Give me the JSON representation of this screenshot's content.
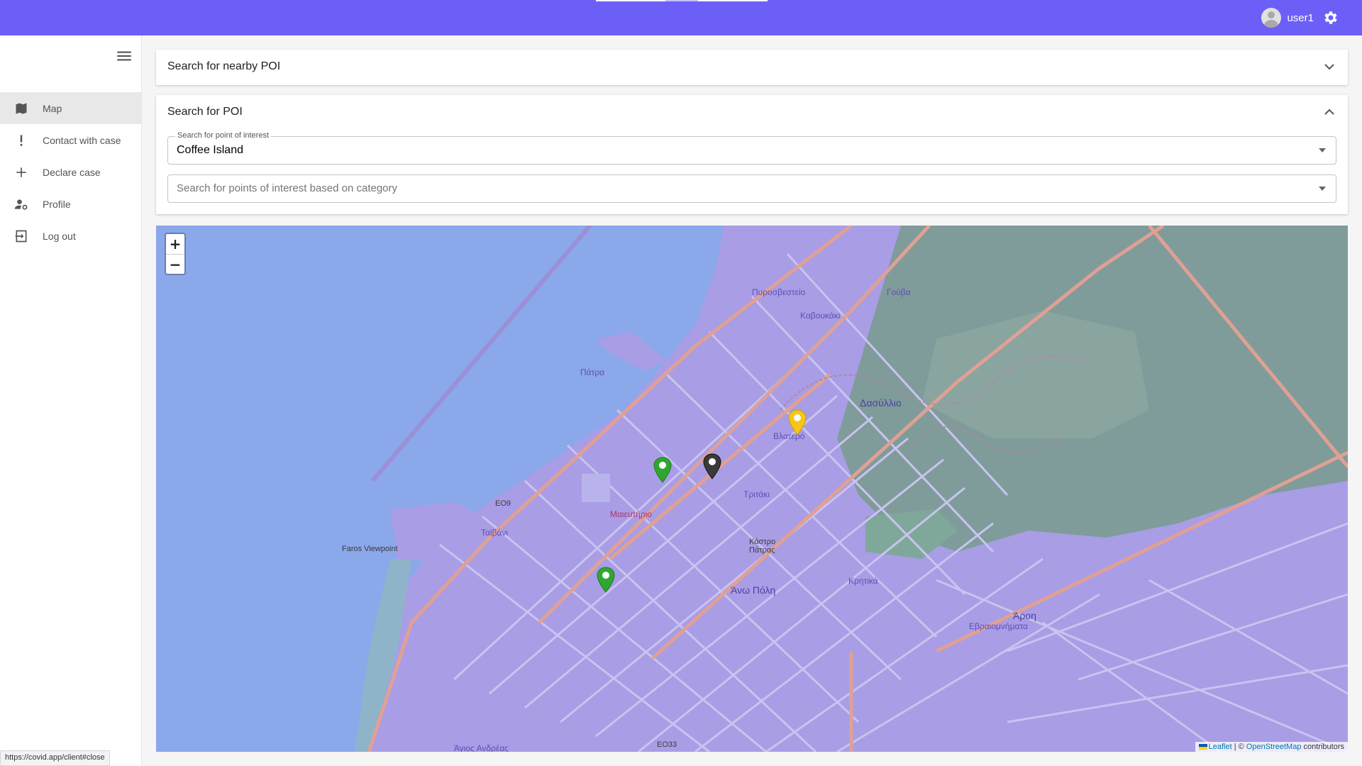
{
  "header": {
    "username": "user1"
  },
  "sidebar": {
    "items": [
      {
        "label": "Map",
        "icon": "map-icon"
      },
      {
        "label": "Contact with case",
        "icon": "exclamation-icon"
      },
      {
        "label": "Declare case",
        "icon": "plus-icon"
      },
      {
        "label": "Profile",
        "icon": "user-gear-icon"
      },
      {
        "label": "Log out",
        "icon": "logout-icon"
      }
    ]
  },
  "nearby_panel": {
    "title": "Search for nearby POI"
  },
  "poi_panel": {
    "title": "Search for POI",
    "poi_field": {
      "label": "Search for point of interest",
      "value": "Coffee Island"
    },
    "category_field": {
      "placeholder": "Search for points of interest based on category"
    }
  },
  "map": {
    "zoom_in": "+",
    "zoom_out": "−",
    "attribution": {
      "leaflet": "Leaflet",
      "separator": "| ©",
      "osm": "OpenStreetMap",
      "contributors": "contributors"
    },
    "labels": {
      "patra": "Πάτρα",
      "dasylio": "Δασύλλιο",
      "vlatero": "Βλατερό",
      "pyrosveteio": "Πυροσβεστείο",
      "gouva": "Γούβα",
      "kavoukaki": "Καβουκάκι",
      "tritaki": "Τριτάκι",
      "kastro": "Κάστρο Πάτρας",
      "ano_poli": "Άνω Πόλη",
      "krytika": "Κρητικά",
      "aroi": "Άροη",
      "evraiomnimata": "Εβραιομνήματα",
      "taivani": "Ταϊβάνι",
      "faros": "Faros Viewpoint",
      "agios_andreas": "Άγιος Ανδρέας",
      "eo9": "ΕΟ9",
      "eo33": "ΕΟ33",
      "maieftirio": "Μαιευτήριο"
    },
    "markers": [
      {
        "type": "green"
      },
      {
        "type": "green"
      },
      {
        "type": "black"
      },
      {
        "type": "yellow"
      }
    ],
    "colors": {
      "water": "#8aa8ea",
      "land": "#a99de6",
      "park": "#7f9c9a",
      "road": "#e0a094",
      "street": "#c9c4ef"
    }
  },
  "status_url": "https://covid.app/client#close"
}
